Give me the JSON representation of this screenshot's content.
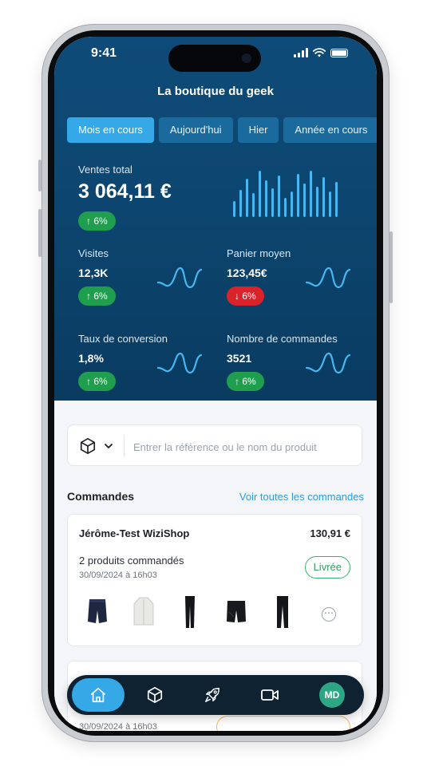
{
  "status_bar": {
    "time": "9:41"
  },
  "header": {
    "shop_name": "La boutique du geek"
  },
  "tabs": [
    {
      "label": "Mois en cours",
      "active": true
    },
    {
      "label": "Aujourd'hui",
      "active": false
    },
    {
      "label": "Hier",
      "active": false
    },
    {
      "label": "Année en cours",
      "active": false
    }
  ],
  "metrics": {
    "total_sales": {
      "label": "Ventes total",
      "value": "3 064,11 €",
      "trend": "↑ 6%",
      "direction": "up"
    },
    "visits": {
      "label": "Visites",
      "value": "12,3K",
      "trend": "↑ 6%",
      "direction": "up"
    },
    "avg_cart": {
      "label": "Panier moyen",
      "value": "123,45€",
      "trend": "↓ 6%",
      "direction": "down"
    },
    "conversion": {
      "label": "Taux de conversion",
      "value": "1,8%",
      "trend": "↑ 6%",
      "direction": "up"
    },
    "orders_count": {
      "label": "Nombre de commandes",
      "value": "3521",
      "trend": "↑ 6%",
      "direction": "up"
    }
  },
  "search": {
    "placeholder": "Entrer la référence ou le nom du produit"
  },
  "orders_section": {
    "title": "Commandes",
    "link": "Voir toutes les commandes"
  },
  "orders": [
    {
      "customer": "Jérôme-Test WiziShop",
      "amount": "130,91 €",
      "products": "2 produits commandés",
      "date": "30/09/2024 à 16h03",
      "status": "Livrée",
      "thumbnails": [
        "shorts-navy",
        "jacket-white",
        "leggings-black",
        "shorts-black",
        "pants-black"
      ]
    },
    {
      "date": "30/09/2024 à 16h03"
    }
  ],
  "bottom_nav": {
    "avatar_initials": "MD"
  },
  "colors": {
    "hero": "#0c4670",
    "accent": "#35a8e8",
    "up": "#1f9e4e",
    "down": "#d9222a",
    "delivered": "#36b36a"
  }
}
